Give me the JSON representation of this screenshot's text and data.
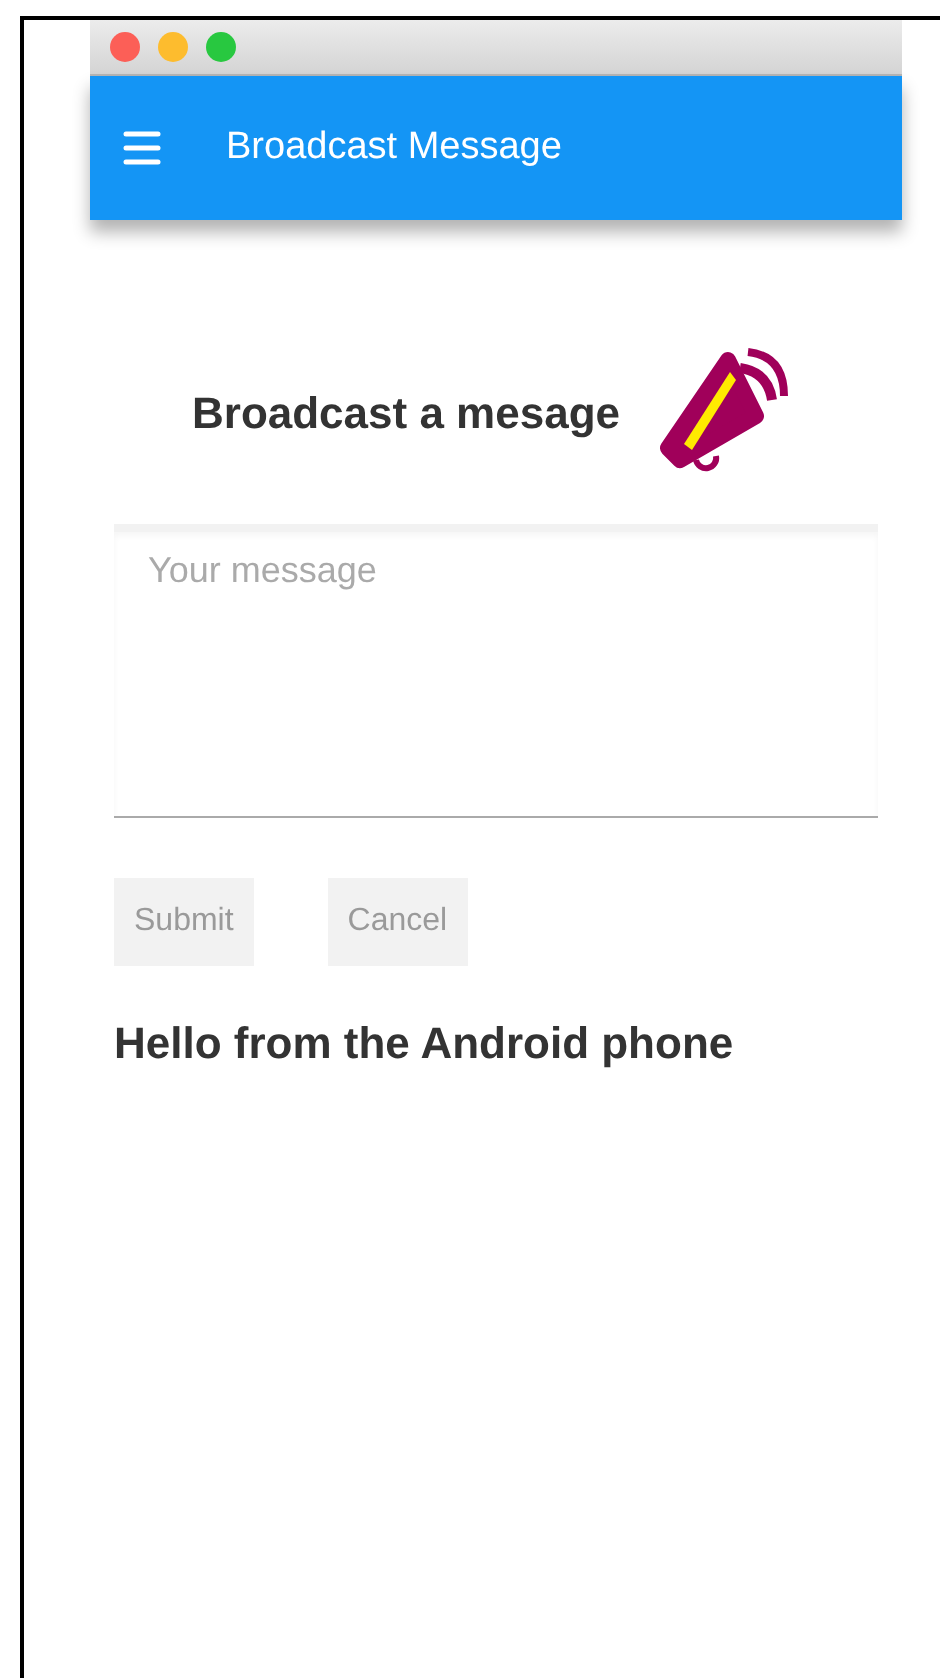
{
  "app_bar": {
    "title": "Broadcast Message"
  },
  "heading": "Broadcast a mesage",
  "message_field": {
    "placeholder": "Your message"
  },
  "buttons": [
    {
      "label": "Submit",
      "disabled": true
    },
    {
      "label": "Cancel",
      "disabled": true
    }
  ],
  "received_message": "Hello from the Android phone"
}
